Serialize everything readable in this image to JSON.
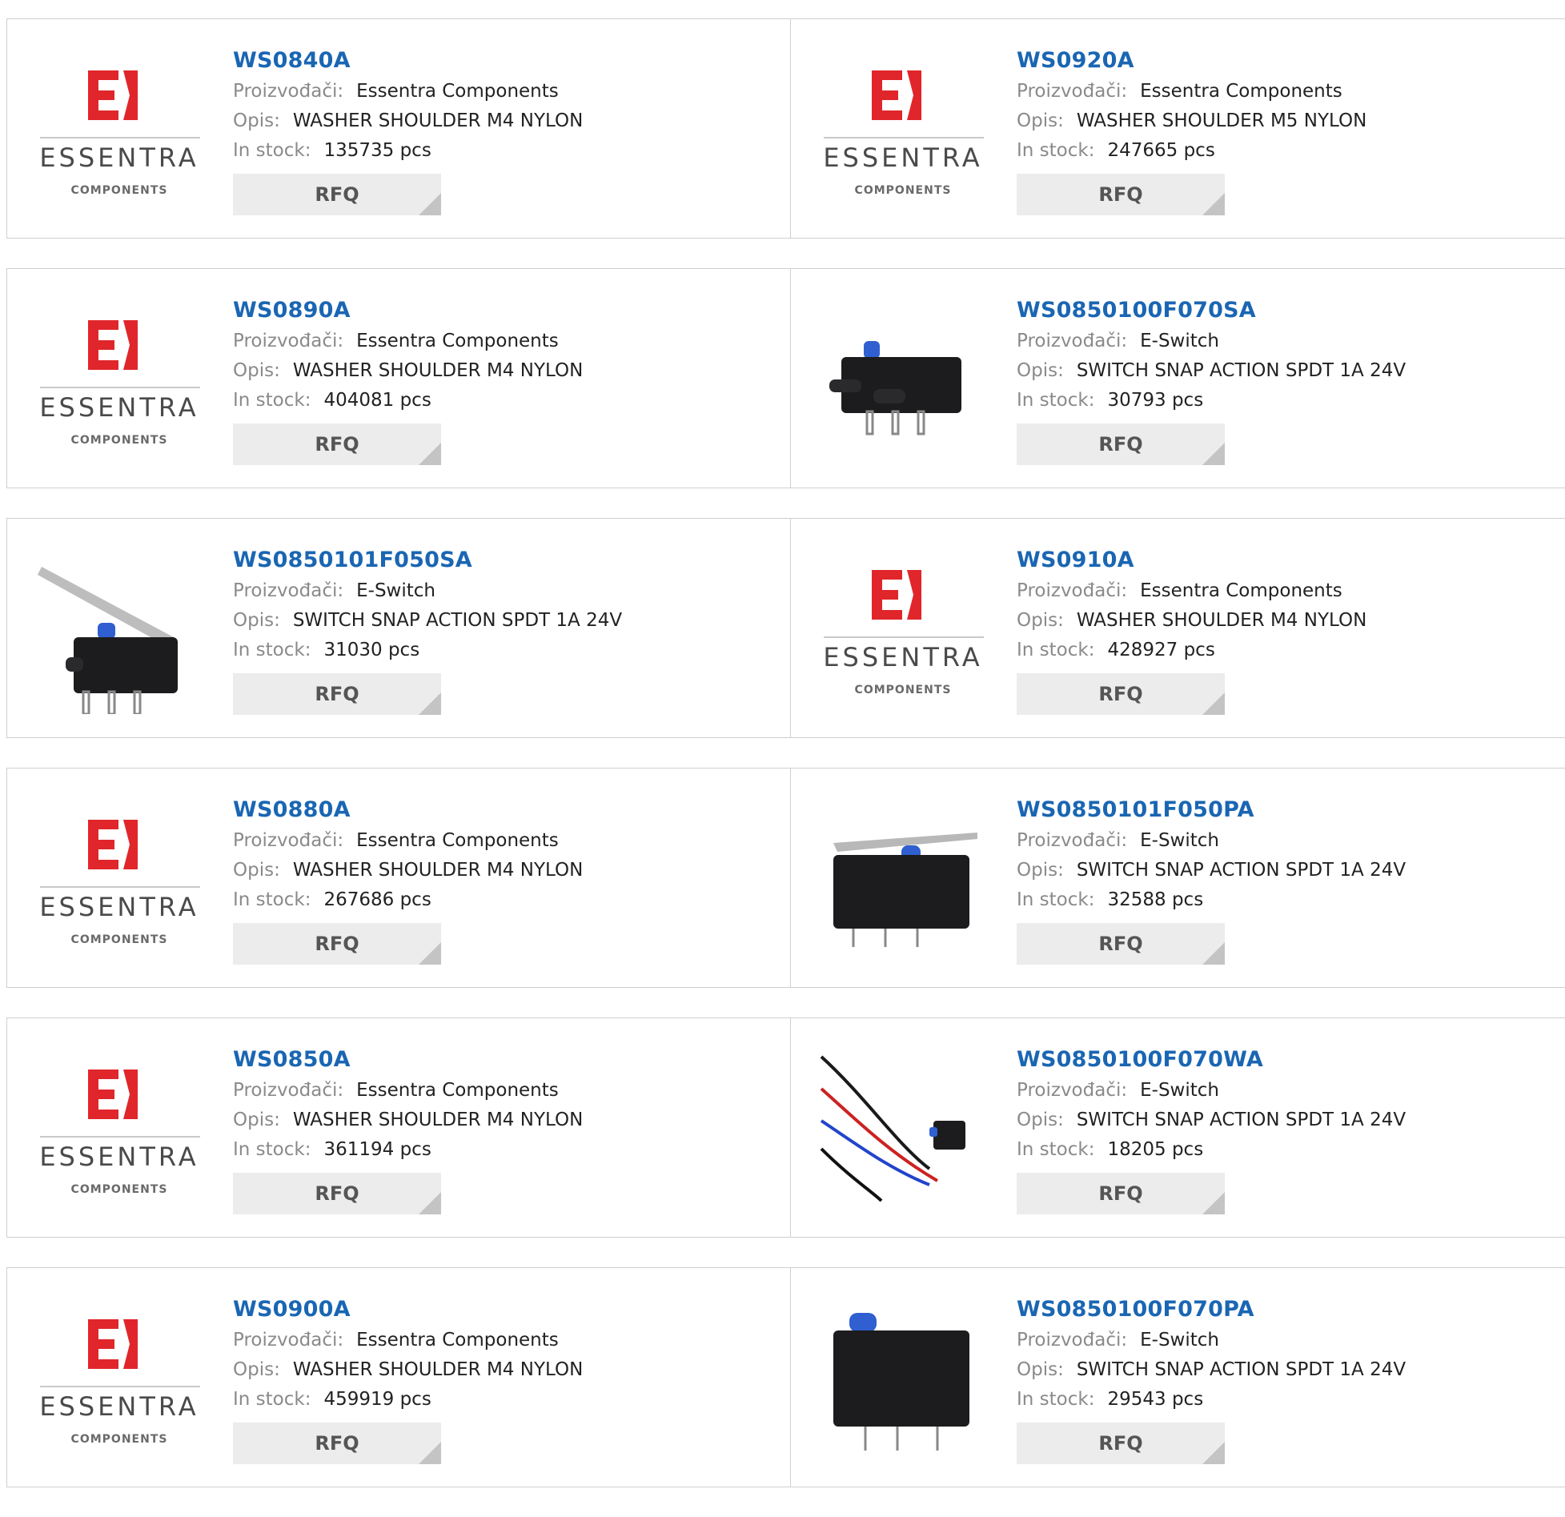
{
  "labels": {
    "manufacturer": "Proizvođači:",
    "description": "Opis:",
    "stock": "In stock:",
    "rfq": "RFQ"
  },
  "brand_logo": {
    "wordmark": "ESSENTRA",
    "subtitle": "COMPONENTS",
    "color_red": "#e0262b",
    "color_grey": "#4a4a4a"
  },
  "products": [
    {
      "part": "WS0840A",
      "manufacturer": "Essentra Components",
      "description": "WASHER SHOULDER M4 NYLON",
      "stock": "135735 pcs",
      "image": "essentra-logo"
    },
    {
      "part": "WS0920A",
      "manufacturer": "Essentra Components",
      "description": "WASHER SHOULDER M5 NYLON",
      "stock": "247665 pcs",
      "image": "essentra-logo"
    },
    {
      "part": "WS0890A",
      "manufacturer": "Essentra Components",
      "description": "WASHER SHOULDER M4 NYLON",
      "stock": "404081 pcs",
      "image": "essentra-logo"
    },
    {
      "part": "WS0850100F070SA",
      "manufacturer": "E-Switch",
      "description": "SWITCH SNAP ACTION SPDT 1A 24V",
      "stock": "30793 pcs",
      "image": "switch-plunger-side"
    },
    {
      "part": "WS0850101F050SA",
      "manufacturer": "E-Switch",
      "description": "SWITCH SNAP ACTION SPDT 1A 24V",
      "stock": "31030 pcs",
      "image": "switch-lever"
    },
    {
      "part": "WS0910A",
      "manufacturer": "Essentra Components",
      "description": "WASHER SHOULDER M4 NYLON",
      "stock": "428927 pcs",
      "image": "essentra-logo"
    },
    {
      "part": "WS0880A",
      "manufacturer": "Essentra Components",
      "description": "WASHER SHOULDER M4 NYLON",
      "stock": "267686 pcs",
      "image": "essentra-logo"
    },
    {
      "part": "WS0850101F050PA",
      "manufacturer": "E-Switch",
      "description": "SWITCH SNAP ACTION SPDT 1A 24V",
      "stock": "32588 pcs",
      "image": "switch-lever-pcb"
    },
    {
      "part": "WS0850A",
      "manufacturer": "Essentra Components",
      "description": "WASHER SHOULDER M4 NYLON",
      "stock": "361194 pcs",
      "image": "essentra-logo"
    },
    {
      "part": "WS0850100F070WA",
      "manufacturer": "E-Switch",
      "description": "SWITCH SNAP ACTION SPDT 1A 24V",
      "stock": "18205 pcs",
      "image": "switch-wired"
    },
    {
      "part": "WS0900A",
      "manufacturer": "Essentra Components",
      "description": "WASHER SHOULDER M4 NYLON",
      "stock": "459919 pcs",
      "image": "essentra-logo"
    },
    {
      "part": "WS0850100F070PA",
      "manufacturer": "E-Switch",
      "description": "SWITCH SNAP ACTION SPDT 1A 24V",
      "stock": "29543 pcs",
      "image": "switch-plunger-pcb"
    }
  ]
}
